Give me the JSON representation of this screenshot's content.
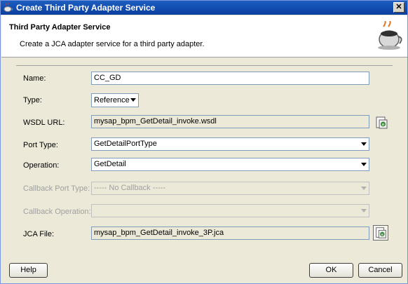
{
  "window": {
    "title": "Create Third Party Adapter Service",
    "close_label": "✕"
  },
  "header": {
    "title": "Third Party Adapter Service",
    "description": "Create a JCA adapter service for a third party adapter."
  },
  "form": {
    "name": {
      "label": "Name:",
      "value": "CC_GD"
    },
    "type": {
      "label": "Type:",
      "value": "Reference"
    },
    "wsdl_url": {
      "label": "WSDL URL:",
      "value": "mysap_bpm_GetDetail_invoke.wsdl"
    },
    "port_type": {
      "label": "Port Type:",
      "value": "GetDetailPortType"
    },
    "operation": {
      "label": "Operation:",
      "value": "GetDetail"
    },
    "callback_port_type": {
      "label": "Callback Port Type:",
      "value": "----- No Callback -----"
    },
    "callback_operation": {
      "label": "Callback Operation:",
      "value": ""
    },
    "jca_file": {
      "label": "JCA File:",
      "value": "mysap_bpm_GetDetail_invoke_3P.jca"
    }
  },
  "footer": {
    "help_label": "Help",
    "ok_label": "OK",
    "cancel_label": "Cancel"
  },
  "icons": {
    "app": "coffee-cup-icon",
    "header": "coffee-cup-icon",
    "browse": "browse-wsdl-icon"
  }
}
